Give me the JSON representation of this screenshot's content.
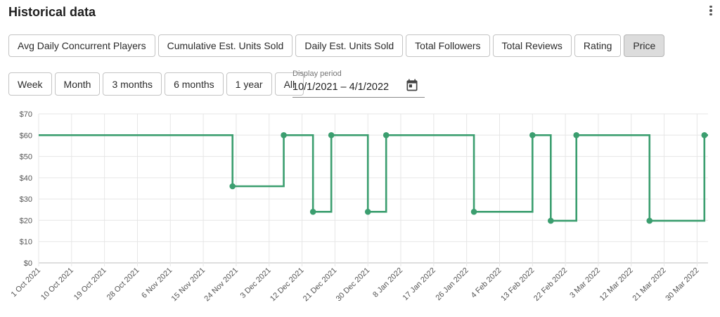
{
  "header": {
    "title": "Historical data",
    "menu_icon": "more-vert-icon"
  },
  "metric_tabs": [
    {
      "label": "Avg Daily Concurrent Players",
      "active": false
    },
    {
      "label": "Cumulative Est. Units Sold",
      "active": false
    },
    {
      "label": "Daily Est. Units Sold",
      "active": false
    },
    {
      "label": "Total Followers",
      "active": false
    },
    {
      "label": "Total Reviews",
      "active": false
    },
    {
      "label": "Rating",
      "active": false
    },
    {
      "label": "Price",
      "active": true
    }
  ],
  "period_buttons": [
    {
      "label": "Week"
    },
    {
      "label": "Month"
    },
    {
      "label": "3 months"
    },
    {
      "label": "6 months"
    },
    {
      "label": "1 year"
    },
    {
      "label": "All"
    }
  ],
  "display_period": {
    "label": "Display period",
    "value": "10/1/2021 – 4/1/2022",
    "icon": "calendar-icon"
  },
  "colors": {
    "line": "#3b9e6f",
    "grid": "#e6e6e6",
    "active_tab": "#dcdcdc"
  },
  "chart_data": {
    "type": "line",
    "step": true,
    "ylim": [
      0,
      70
    ],
    "y_ticks": [
      "$0",
      "$10",
      "$20",
      "$30",
      "$40",
      "$50",
      "$60",
      "$70"
    ],
    "x_range": [
      "2021-10-01",
      "2022-04-02"
    ],
    "x_ticks": [
      "1 Oct 2021",
      "10 Oct 2021",
      "19 Oct 2021",
      "28 Oct 2021",
      "6 Nov 2021",
      "15 Nov 2021",
      "24 Nov 2021",
      "3 Dec 2021",
      "12 Dec 2021",
      "21 Dec 2021",
      "30 Dec 2021",
      "8 Jan 2022",
      "17 Jan 2022",
      "26 Jan 2022",
      "4 Feb 2022",
      "13 Feb 2022",
      "22 Feb 2022",
      "3 Mar 2022",
      "12 Mar 2022",
      "21 Mar 2022",
      "30 Mar 2022"
    ],
    "x_tick_dates": [
      "2021-10-01",
      "2021-10-10",
      "2021-10-19",
      "2021-10-28",
      "2021-11-06",
      "2021-11-15",
      "2021-11-24",
      "2021-12-03",
      "2021-12-12",
      "2021-12-21",
      "2021-12-30",
      "2022-01-08",
      "2022-01-17",
      "2022-01-26",
      "2022-02-04",
      "2022-02-13",
      "2022-02-22",
      "2022-03-03",
      "2022-03-12",
      "2022-03-21",
      "2022-03-30"
    ],
    "grid": true,
    "points": [
      {
        "date": "2021-10-01",
        "price": 60,
        "marker": false
      },
      {
        "date": "2021-11-23",
        "price": 35.99,
        "marker": true
      },
      {
        "date": "2021-12-07",
        "price": 59.99,
        "marker": true
      },
      {
        "date": "2021-12-15",
        "price": 23.99,
        "marker": true
      },
      {
        "date": "2021-12-20",
        "price": 59.99,
        "marker": true
      },
      {
        "date": "2021-12-30",
        "price": 23.99,
        "marker": true
      },
      {
        "date": "2022-01-04",
        "price": 59.99,
        "marker": true
      },
      {
        "date": "2022-01-28",
        "price": 23.99,
        "marker": true
      },
      {
        "date": "2022-02-13",
        "price": 59.99,
        "marker": true
      },
      {
        "date": "2022-02-18",
        "price": 19.79,
        "marker": true
      },
      {
        "date": "2022-02-25",
        "price": 59.99,
        "marker": true
      },
      {
        "date": "2022-03-17",
        "price": 19.79,
        "marker": true
      },
      {
        "date": "2022-04-01",
        "price": 59.99,
        "marker": true
      }
    ]
  }
}
